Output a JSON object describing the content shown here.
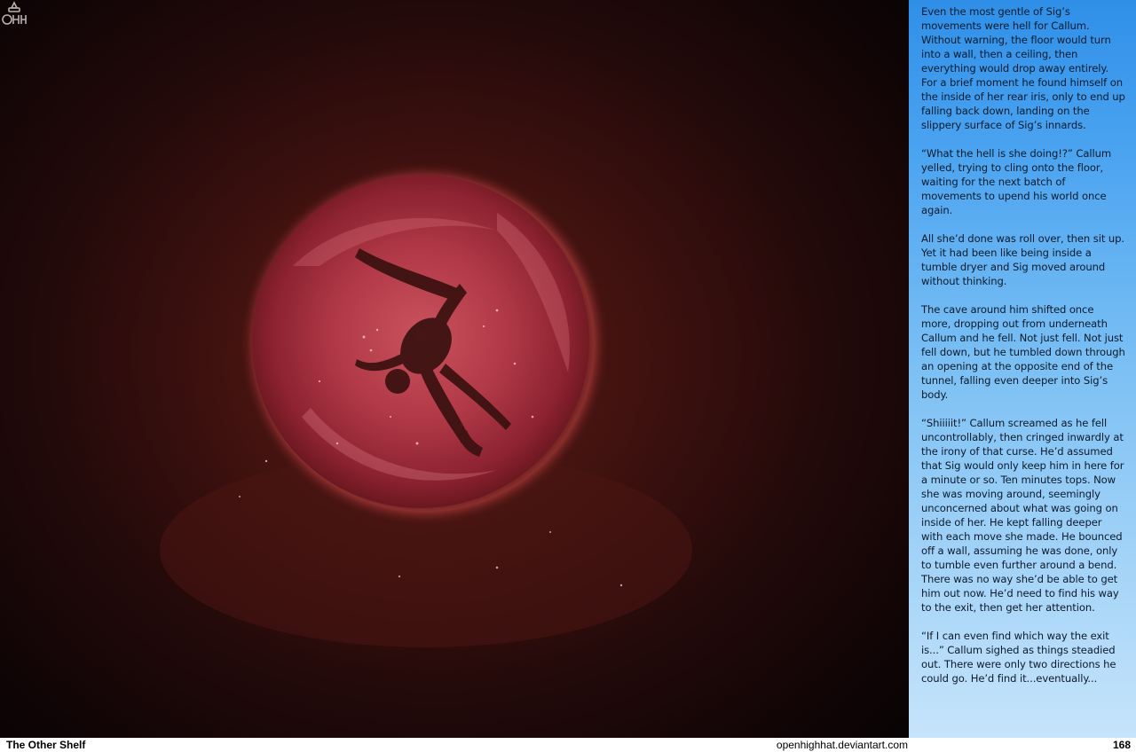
{
  "story": {
    "paragraphs": [
      "Even the most gentle of Sig’s movements were hell for Callum. Without warning, the floor would turn into a wall, then a ceiling, then everything would drop away entirely. For a brief moment he found himself on the inside of her rear iris, only to end up falling back down, landing on the slippery surface of Sig’s innards.",
      "“What the hell is she doing!?” Callum yelled, trying to cling onto the floor, waiting for the next batch of movements to upend his world once again.",
      "All she’d done was roll over, then sit up. Yet it had been like being inside a tumble dryer and Sig moved around without thinking.",
      "The cave around him shifted once more, dropping out from underneath Callum and he fell. Not just fell. Not just fell down, but he tumbled down through an opening at the opposite end of the tunnel, falling even deeper into Sig’s body.",
      "“Shiiiiit!” Callum screamed as he fell uncontrollably, then cringed inwardly at the irony of that curse. He’d assumed that Sig would only keep him in here for a minute or so. Ten minutes tops. Now she was moving around, seemingly unconcerned about what was going on inside of her. He kept falling deeper with each move she made. He bounced off a wall, assuming he was done, only to tumble even further around a bend. There was no way she’d be able to get him out now. He’d need to find his way to the exit, then get her attention.",
      "“If I can even find which way the exit is...” Callum sighed as things steadied out. There were only two directions he could go. He’d find it...eventually..."
    ]
  },
  "footer": {
    "series_title": "The Other Shelf",
    "website": "openhighhat.deviantart.com",
    "page_number": "168"
  },
  "artwork": {
    "logo_icon": "ohh-logo-icon"
  }
}
